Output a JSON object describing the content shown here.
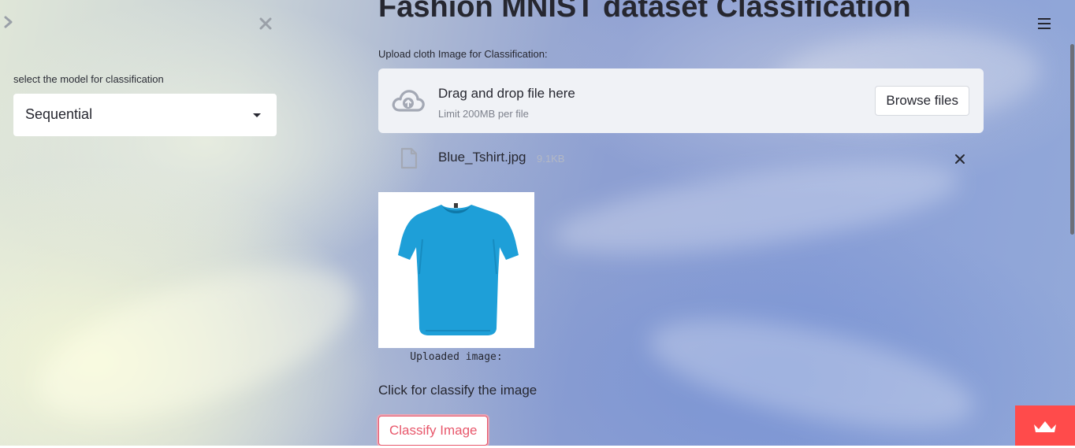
{
  "sidebar": {
    "model_label": "select the model for classification",
    "model_select": {
      "selected": "Sequential"
    }
  },
  "main": {
    "title": "Fashion MNIST dataset Classification",
    "uploader": {
      "label": "Upload cloth Image for Classification:",
      "drop_text": "Drag and drop file here",
      "limit_text": "Limit 200MB per file",
      "browse_label": "Browse files"
    },
    "uploaded_file": {
      "name": "Blue_Tshirt.jpg",
      "size": "9.1KB"
    },
    "image": {
      "caption": "Uploaded image:"
    },
    "classify_prompt": "Click for classify the image",
    "classify_button": "Classify Image"
  },
  "icons": {
    "sidebar_expand": "chevron-right-icon",
    "sidebar_close": "close-icon",
    "menu": "hamburger-menu-icon",
    "upload": "cloud-upload-icon",
    "file": "file-icon",
    "remove_file": "close-icon",
    "app_badge": "crown-icon"
  },
  "colors": {
    "accent": "#ff4b4b",
    "button_text": "#e8576b",
    "text": "#262730",
    "dropzone_bg": "#f0f2f6",
    "shirt": "#1e9fd8"
  }
}
